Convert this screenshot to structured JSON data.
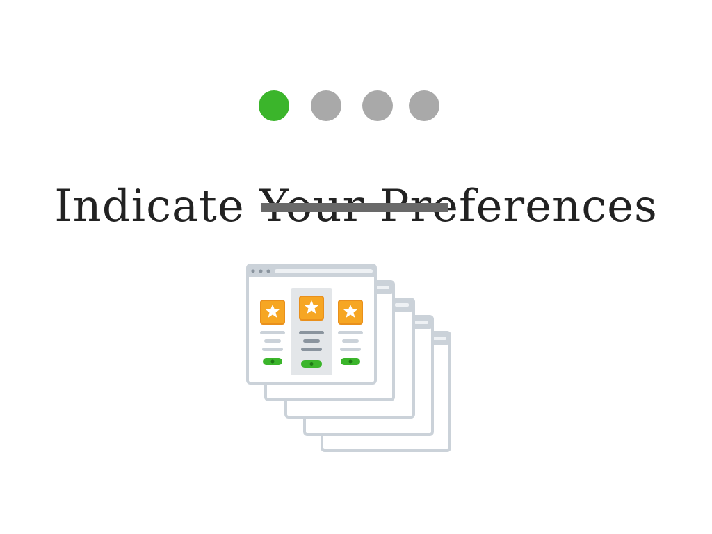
{
  "progress": {
    "total_steps": 4,
    "current_step": 1,
    "active_color": "#3bb52b",
    "inactive_color": "#a9a9a9"
  },
  "heading": {
    "text": "Indicate Your Preferences"
  },
  "illustration": {
    "icon": "stacked-preference-cards-illustration",
    "accent_orange": "#f6a623",
    "accent_green": "#3bb52b",
    "frame_color": "#cbd2d9"
  }
}
